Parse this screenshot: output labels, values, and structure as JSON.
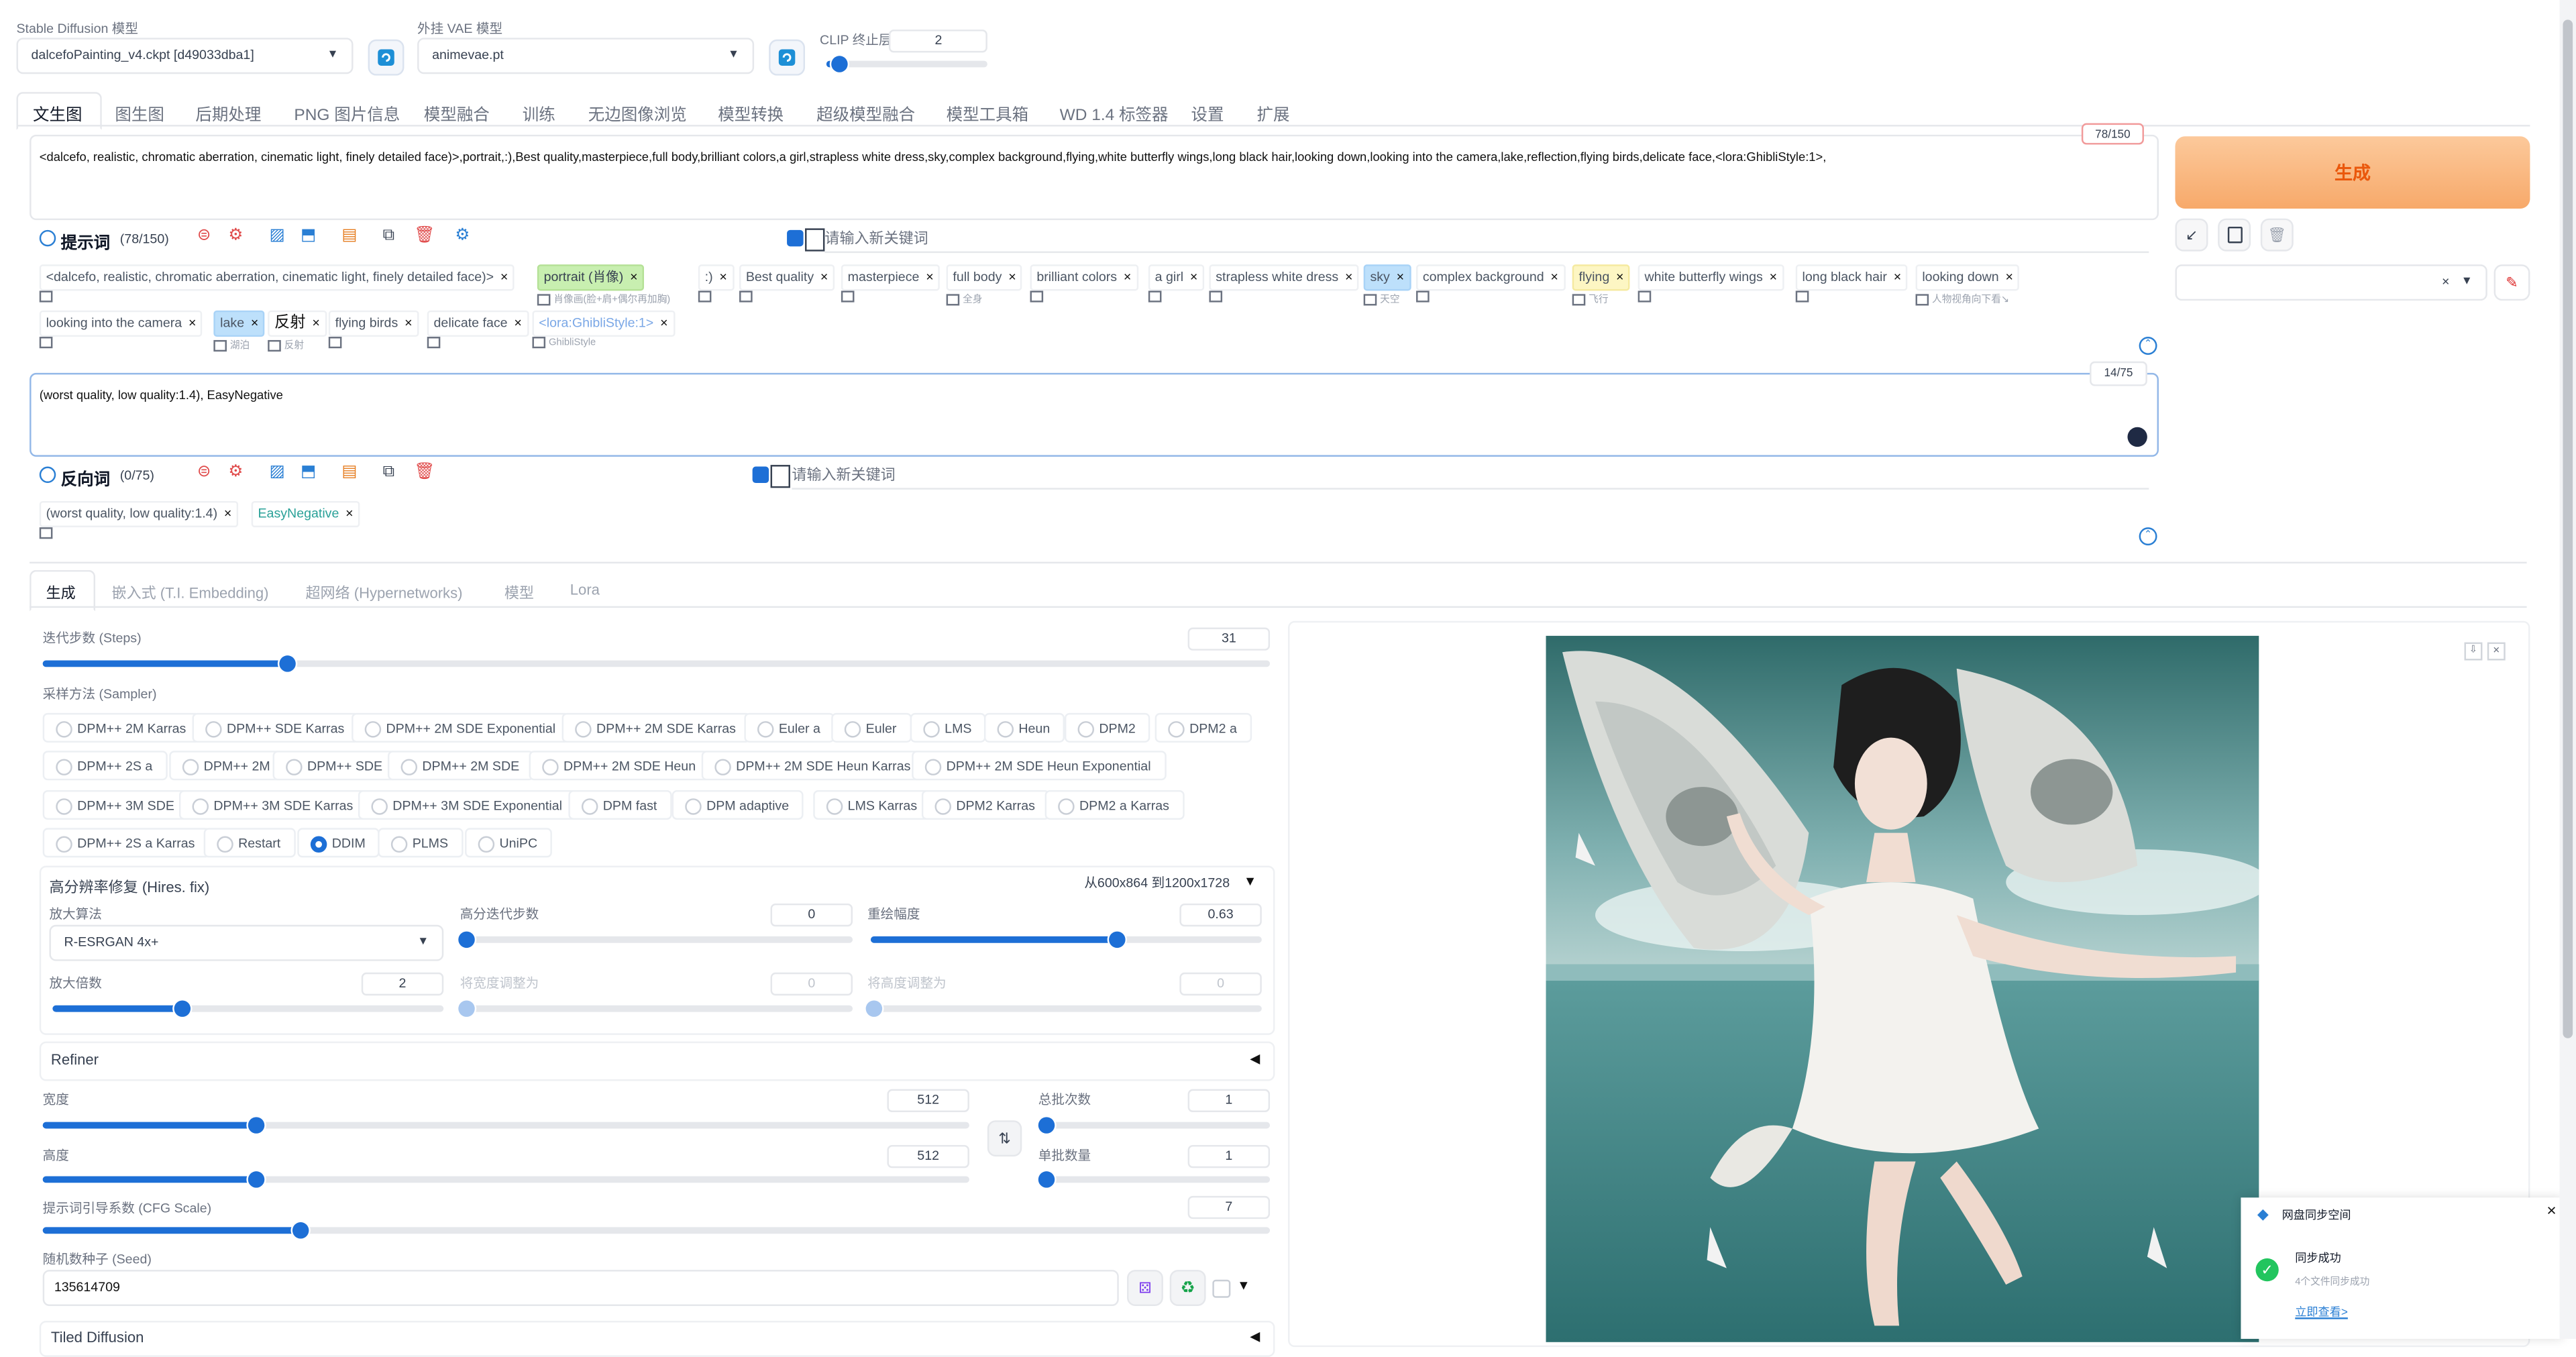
{
  "top": {
    "sd_model_label": "Stable Diffusion 模型",
    "sd_model_value": "dalcefoPainting_v4.ckpt [d49033dba1]",
    "vae_label": "外挂 VAE 模型",
    "vae_value": "animevae.pt",
    "clip_label": "CLIP 终止层数",
    "clip_value": "2",
    "clip_fraction": 0.08
  },
  "tabs": [
    "文生图",
    "图生图",
    "后期处理",
    "PNG 图片信息",
    "模型融合",
    "训练",
    "无边图像浏览",
    "模型转换",
    "超级模型融合",
    "模型工具箱",
    "WD 1.4 标签器",
    "设置",
    "扩展"
  ],
  "prompt": {
    "text": "<dalcefo, realistic, chromatic aberration, cinematic light, finely detailed face)>,portrait,:),Best quality,masterpiece,full body,brilliant colors,a girl,strapless white dress,sky,complex background,flying,white butterfly wings,long black hair,looking down,looking into the camera,lake,reflection,flying birds,delicate face,<lora:GhibliStyle:1>,",
    "counter": "78/150",
    "section_title": "提示词",
    "section_count": "(78/150)",
    "new_keyword_placeholder": "请输入新关键词",
    "tags": [
      {
        "text": "<dalcefo, realistic, chromatic aberration, cinematic light, finely detailed face)>",
        "sub": ""
      },
      {
        "text": "portrait (肖像)",
        "sub": "肖像画(脸+肩+偶尔再加胸)"
      },
      {
        "text": ":)",
        "sub": ""
      },
      {
        "text": "Best quality",
        "sub": ""
      },
      {
        "text": "masterpiece",
        "sub": ""
      },
      {
        "text": "full body",
        "sub": "全身"
      },
      {
        "text": "brilliant colors",
        "sub": ""
      },
      {
        "text": "a girl",
        "sub": ""
      },
      {
        "text": "strapless white dress",
        "sub": ""
      },
      {
        "text": "sky",
        "sub": "天空"
      },
      {
        "text": "complex background",
        "sub": ""
      },
      {
        "text": "flying",
        "sub": "飞行"
      },
      {
        "text": "white butterfly wings",
        "sub": ""
      },
      {
        "text": "long black hair",
        "sub": ""
      },
      {
        "text": "looking down",
        "sub": "人物视角向下看↘"
      },
      {
        "text": "looking into the camera",
        "sub": ""
      },
      {
        "text": "lake",
        "sub": "湖泊"
      },
      {
        "text": "反射",
        "sub": "反射"
      },
      {
        "text": "flying birds",
        "sub": ""
      },
      {
        "text": "delicate face",
        "sub": ""
      },
      {
        "text": "<lora:GhibliStyle:1>",
        "sub": "GhibliStyle"
      }
    ]
  },
  "negative": {
    "text": "(worst quality, low quality:1.4), EasyNegative",
    "counter": "14/75",
    "section_title": "反向词",
    "section_count": "(0/75)",
    "new_keyword_placeholder": "请输入新关键词",
    "tags": [
      {
        "text": "(worst quality, low quality:1.4)"
      },
      {
        "text": "EasyNegative"
      }
    ]
  },
  "generate": {
    "label": "生成"
  },
  "subtabs": [
    "生成",
    "嵌入式 (T.I. Embedding)",
    "超网络 (Hypernetworks)",
    "模型",
    "Lora"
  ],
  "params": {
    "steps_label": "迭代步数 (Steps)",
    "steps": "31",
    "steps_fraction": 0.2,
    "sampler_label": "采样方法 (Sampler)",
    "samplers": [
      "DPM++ 2M Karras",
      "DPM++ SDE Karras",
      "DPM++ 2M SDE Exponential",
      "DPM++ 2M SDE Karras",
      "Euler a",
      "Euler",
      "LMS",
      "Heun",
      "DPM2",
      "DPM2 a",
      "DPM++ 2S a",
      "DPM++ 2M",
      "DPM++ SDE",
      "DPM++ 2M SDE",
      "DPM++ 2M SDE Heun",
      "DPM++ 2M SDE Heun Karras",
      "DPM++ 2M SDE Heun Exponential",
      "DPM++ 3M SDE",
      "DPM++ 3M SDE Karras",
      "DPM++ 3M SDE Exponential",
      "DPM fast",
      "DPM adaptive",
      "LMS Karras",
      "DPM2 Karras",
      "DPM2 a Karras",
      "DPM++ 2S a Karras",
      "Restart",
      "DDIM",
      "PLMS",
      "UniPC"
    ],
    "sampler_selected": "DDIM",
    "hires_label": "高分辨率修复 (Hires. fix)",
    "hires_info": "从600x864 到1200x1728",
    "upscaler_label": "放大算法",
    "upscaler": "R-ESRGAN 4x+",
    "hires_steps_label": "高分迭代步数",
    "hires_steps": "0",
    "denoise_label": "重绘幅度",
    "denoise": "0.63",
    "denoise_fraction": 0.63,
    "scale_label": "放大倍数",
    "scale": "2",
    "scale_fraction": 0.33,
    "resize_w_label": "将宽度调整为",
    "resize_w": "0",
    "resize_h_label": "将高度调整为",
    "resize_h": "0",
    "refiner_label": "Refiner",
    "width_label": "宽度",
    "width": "512",
    "width_fraction": 0.23,
    "height_label": "高度",
    "height": "512",
    "height_fraction": 0.23,
    "batch_count_label": "总批次数",
    "batch_count": "1",
    "batch_size_label": "单批数量",
    "batch_size": "1",
    "cfg_label": "提示词引导系数 (CFG Scale)",
    "cfg": "7",
    "cfg_fraction": 0.21,
    "seed_label": "随机数种子 (Seed)",
    "seed": "135614709",
    "tiled_label": "Tiled Diffusion"
  },
  "notify": {
    "title": "网盘同步空间",
    "status": "同步成功",
    "detail": "4个文件同步成功",
    "link": "立即查看>"
  }
}
